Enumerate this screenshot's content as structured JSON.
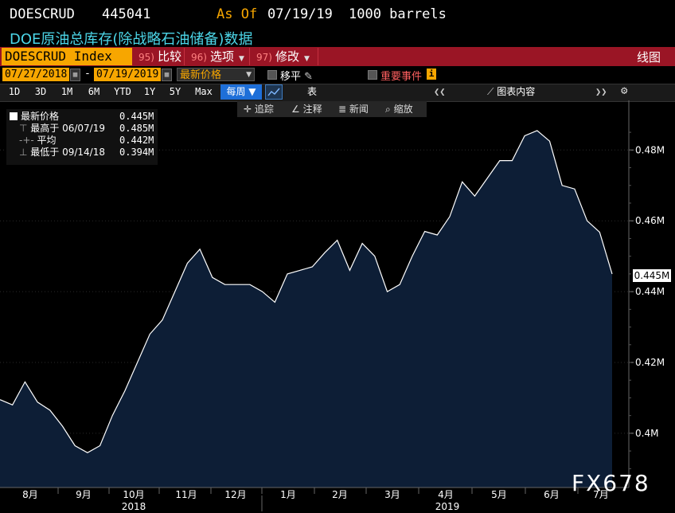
{
  "header": {
    "ticker": "DOESCRUD",
    "price": "445041",
    "asof_label": "As Of",
    "asof_date": "07/19/19",
    "units": "1000 barrels",
    "subtitle": "DOE原油总库存(除战略石油储备)数据"
  },
  "toolbar": {
    "index": "DOESCRUD Index",
    "compare_num": "95)",
    "compare": "比较",
    "options_num": "96)",
    "options": "选项",
    "edit_num": "97)",
    "edit": "修改",
    "chart": "线图"
  },
  "dates": {
    "start": "07/27/2018",
    "end": "07/19/2019",
    "separator": "-",
    "price_type": "最新价格",
    "move": "移平",
    "events": "重要事件"
  },
  "periods": [
    "1D",
    "3D",
    "1M",
    "6M",
    "YTD",
    "1Y",
    "5Y",
    "Max"
  ],
  "frequency": "每周 ▼",
  "table_label": "表",
  "chart_content": "图表内容",
  "annotations": {
    "track": "追踪",
    "annotate": "注释",
    "news": "新闻",
    "zoom": "缩放"
  },
  "legend": {
    "last_label": "最新价格",
    "last_value": "0.445M",
    "high_label": "最高于 06/07/19",
    "high_value": "0.485M",
    "avg_label": "平均",
    "avg_value": "0.442M",
    "low_label": "最低于 09/14/18",
    "low_value": "0.394M"
  },
  "colors": {
    "area_fill": "#0d1e36",
    "line": "#ffffff",
    "accent_orange": "#f7a600",
    "toolbar_red": "#9a1525",
    "subtitle_cyan": "#4cd6e8"
  },
  "watermark": "FX678",
  "chart_data": {
    "type": "area",
    "title": "",
    "ylabel": "",
    "xlabel": "",
    "ylim": [
      0.385,
      0.495
    ],
    "y_ticks": [
      "0.4M",
      "0.42M",
      "0.44M",
      "0.46M",
      "0.48M"
    ],
    "y_tick_values": [
      0.4,
      0.42,
      0.44,
      0.46,
      0.48
    ],
    "last_value_label": "0.445M",
    "x_month_labels": [
      "8月",
      "9月",
      "10月",
      "11月",
      "12月",
      "1月",
      "2月",
      "3月",
      "4月",
      "5月",
      "6月",
      "7月"
    ],
    "x_year_labels": [
      "2018",
      "2019"
    ],
    "series": [
      {
        "values": [
          0.4095,
          0.408,
          0.4145,
          0.4088,
          0.4065,
          0.402,
          0.3965,
          0.3945,
          0.3965,
          0.405,
          0.412,
          0.42,
          0.428,
          0.432,
          0.44,
          0.448,
          0.452,
          0.444,
          0.442,
          0.442,
          0.442,
          0.44,
          0.437,
          0.445,
          0.446,
          0.447,
          0.451,
          0.4545,
          0.446,
          0.4536,
          0.45,
          0.44,
          0.442,
          0.45,
          0.457,
          0.456,
          0.4612,
          0.471,
          0.467,
          0.472,
          0.477,
          0.477,
          0.484,
          0.4855,
          0.4825,
          0.47,
          0.469,
          0.46,
          0.4568,
          0.445
        ]
      }
    ]
  }
}
